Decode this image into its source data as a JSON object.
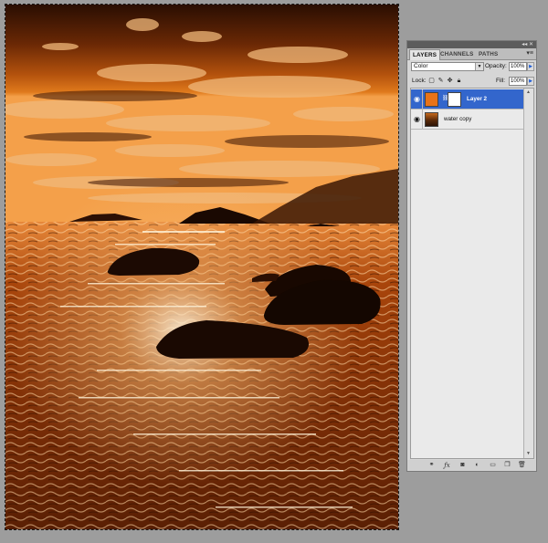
{
  "panel": {
    "tabs": [
      "LAYERS",
      "CHANNELS",
      "PATHS"
    ],
    "blend_mode": "Color",
    "opacity_label": "Opacity:",
    "opacity_value": "100%",
    "lock_label": "Lock:",
    "fill_label": "Fill:",
    "fill_value": "100%",
    "layers": [
      {
        "name": "Layer 2",
        "selected": true,
        "visible": true,
        "thumb_color": "#e87318"
      },
      {
        "name": "water copy",
        "selected": false,
        "visible": true,
        "thumb_color": "#5a3a1a"
      }
    ],
    "bottom_icons": [
      "link-layers-icon",
      "fx-icon",
      "add-mask-icon",
      "adjustment-layer-icon",
      "new-group-icon",
      "new-layer-icon",
      "trash-icon"
    ]
  },
  "colors": {
    "selection_blue": "#3366cc",
    "photo_tint": "#d9650f",
    "workspace_gray": "#9d9d9d"
  }
}
